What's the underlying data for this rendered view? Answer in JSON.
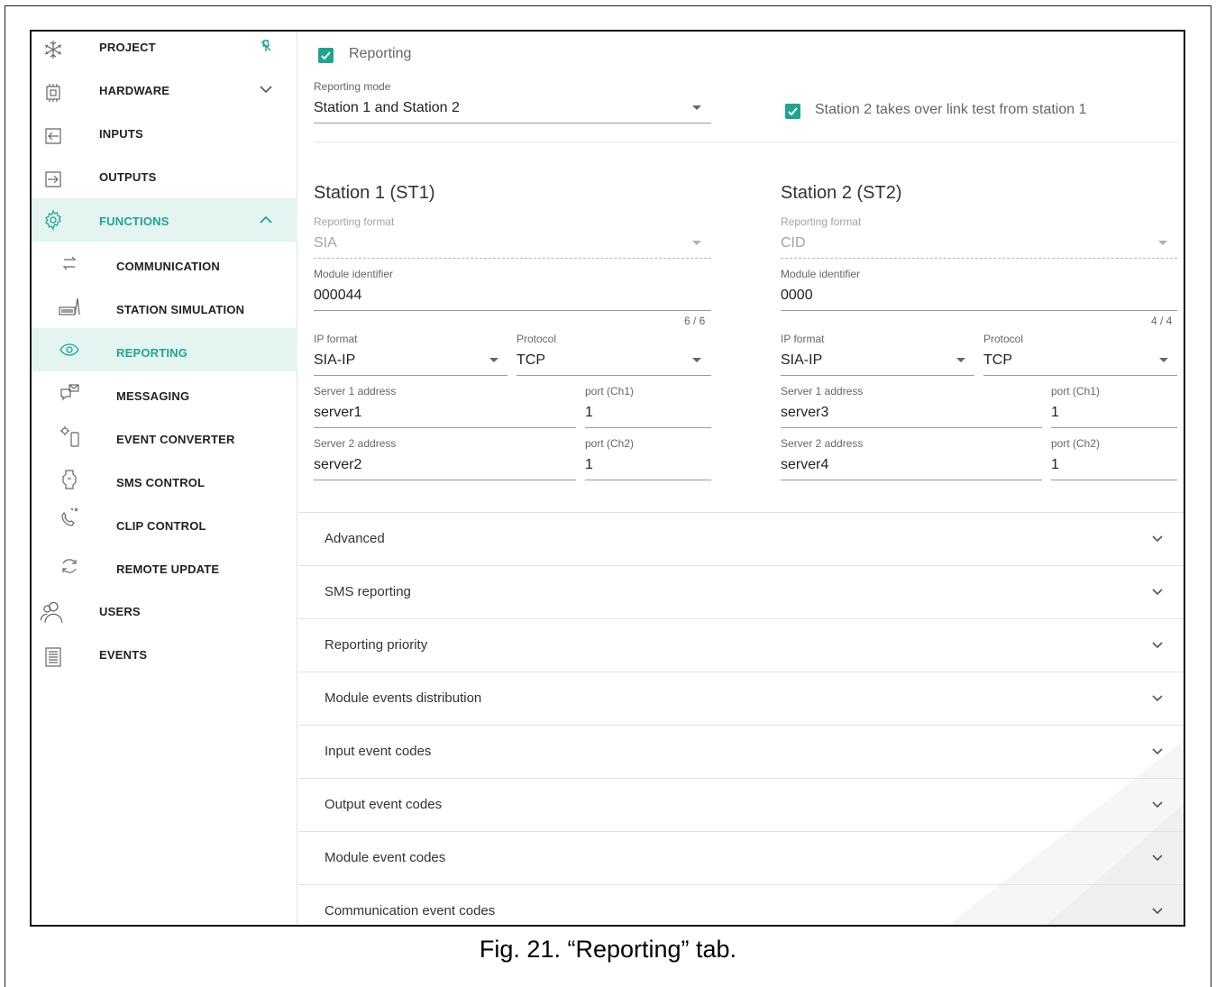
{
  "sidebar": {
    "items": [
      {
        "label": "PROJECT",
        "icon": "snowflake-icon"
      },
      {
        "label": "HARDWARE",
        "icon": "chip-icon"
      },
      {
        "label": "INPUTS",
        "icon": "input-arrow-icon"
      },
      {
        "label": "OUTPUTS",
        "icon": "output-arrow-icon"
      },
      {
        "label": "FUNCTIONS",
        "icon": "gear-icon"
      },
      {
        "label": "COMMUNICATION",
        "icon": "exchange-arrows-icon"
      },
      {
        "label": "STATION SIMULATION",
        "icon": "station-icon"
      },
      {
        "label": "REPORTING",
        "icon": "eye-icon"
      },
      {
        "label": "MESSAGING",
        "icon": "chat-mail-icon"
      },
      {
        "label": "EVENT CONVERTER",
        "icon": "event-converter-icon"
      },
      {
        "label": "SMS CONTROL",
        "icon": "sms-control-icon"
      },
      {
        "label": "CLIP CONTROL",
        "icon": "clip-phone-icon"
      },
      {
        "label": "REMOTE UPDATE",
        "icon": "refresh-icon"
      },
      {
        "label": "USERS",
        "icon": "users-icon"
      },
      {
        "label": "EVENTS",
        "icon": "document-list-icon"
      }
    ],
    "pin_icon": "pin-icon"
  },
  "reporting": {
    "enabled_label": "Reporting",
    "enabled": true,
    "mode_label": "Reporting mode",
    "mode_value": "Station 1 and Station 2",
    "takeover_label": "Station 2 takes over link test from station 1",
    "takeover": true
  },
  "station1": {
    "title": "Station 1 (ST1)",
    "format_label": "Reporting format",
    "format_value": "SIA",
    "id_label": "Module identifier",
    "id_value": "000044",
    "id_counter": "6 / 6",
    "ip_format_label": "IP format",
    "ip_format_value": "SIA-IP",
    "protocol_label": "Protocol",
    "protocol_value": "TCP",
    "server1_label": "Server 1 address",
    "server1_value": "server1",
    "port1_label": "port (Ch1)",
    "port1_value": "1",
    "server2_label": "Server 2 address",
    "server2_value": "server2",
    "port2_label": "port (Ch2)",
    "port2_value": "1"
  },
  "station2": {
    "title": "Station 2 (ST2)",
    "format_label": "Reporting format",
    "format_value": "CID",
    "id_label": "Module identifier",
    "id_value": "0000",
    "id_counter": "4 / 4",
    "ip_format_label": "IP format",
    "ip_format_value": "SIA-IP",
    "protocol_label": "Protocol",
    "protocol_value": "TCP",
    "server1_label": "Server 1 address",
    "server1_value": "server3",
    "port1_label": "port (Ch1)",
    "port1_value": "1",
    "server2_label": "Server 2 address",
    "server2_value": "server4",
    "port2_label": "port (Ch2)",
    "port2_value": "1"
  },
  "accordion": [
    "Advanced",
    "SMS reporting",
    "Reporting priority",
    "Module events distribution",
    "Input event codes",
    "Output event codes",
    "Module event codes",
    "Communication event codes"
  ],
  "caption": "Fig. 21. “Reporting” tab.",
  "colors": {
    "accent": "#1fa58d",
    "active_bg": "#e3f4f1"
  }
}
